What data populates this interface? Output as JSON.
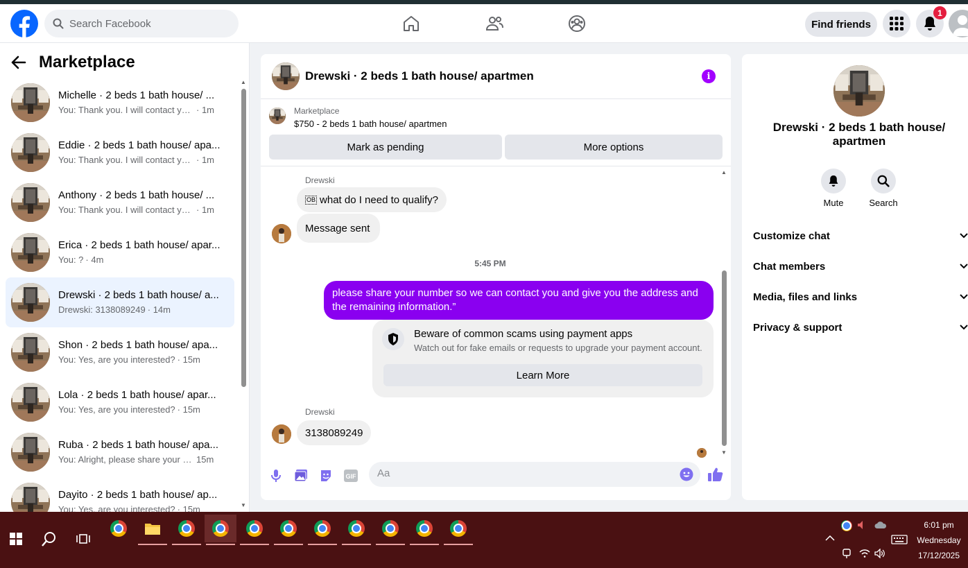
{
  "header": {
    "search_placeholder": "Search Facebook",
    "find_friends_label": "Find friends",
    "notification_count": "1"
  },
  "sidebar": {
    "title": "Marketplace",
    "conversations": [
      {
        "title": "Michelle · 2 beds 1 bath house/ ...",
        "preview": "You: Thank you. I will contact you ...",
        "time": "· 1m",
        "active": false
      },
      {
        "title": "Eddie · 2 beds 1 bath house/ apa...",
        "preview": "You: Thank you. I will contact you ...",
        "time": "· 1m",
        "active": false
      },
      {
        "title": "Anthony · 2 beds 1 bath house/ ...",
        "preview": "You: Thank you. I will contact you ...",
        "time": "· 1m",
        "active": false
      },
      {
        "title": "Erica · 2 beds 1 bath house/ apar...",
        "preview": "You: ?",
        "time": "· 4m",
        "active": false
      },
      {
        "title": "Drewski · 2 beds 1 bath house/ a...",
        "preview": "Drewski: 3138089249",
        "time": "· 14m",
        "active": true
      },
      {
        "title": "Shon · 2 beds 1 bath house/ apa...",
        "preview": "You: Yes, are you interested?",
        "time": "· 15m",
        "active": false
      },
      {
        "title": "Lola · 2 beds 1 bath house/ apar...",
        "preview": "You: Yes, are you interested?",
        "time": "· 15m",
        "active": false
      },
      {
        "title": "Ruba · 2 beds 1 bath house/ apa...",
        "preview": "You: Alright, please share your nu...",
        "time": "15m",
        "active": false
      },
      {
        "title": "Dayito · 2 beds 1 bath house/ ap...",
        "preview": "You: Yes, are you interested?",
        "time": "· 15m",
        "active": false
      }
    ]
  },
  "chat": {
    "title": "Drewski · 2 beds 1 bath house/ apartmen",
    "marketplace_label": "Marketplace",
    "listing": "$750 - 2 beds 1 bath house/ apartmen",
    "mark_pending_label": "Mark as pending",
    "more_options_label": "More options",
    "sender_name_1": "Drewski",
    "msg_in_1": "what do I need to qualify?",
    "msg_in_1_prefix": "OB",
    "msg_in_2": "Message sent",
    "timestamp": "5:45 PM",
    "msg_out": "please share your number so we can contact you and give you the address and the remaining information.”",
    "warning_title": "Beware of common scams using payment apps",
    "warning_sub": "Watch out for fake emails or requests to upgrade your payment account.",
    "learn_more_label": "Learn More",
    "sender_name_2": "Drewski",
    "msg_in_3": "3138089249",
    "composer_placeholder": "Aa",
    "accent_color": "#8a00f0"
  },
  "details": {
    "name": "Drewski · 2 beds 1 bath house/ apartmen",
    "mute_label": "Mute",
    "search_label": "Search",
    "sections": [
      "Customize chat",
      "Chat members",
      "Media, files and links",
      "Privacy & support"
    ]
  },
  "taskbar": {
    "time": "6:01 pm",
    "day": "Wednesday",
    "date": "17/12/2025"
  }
}
